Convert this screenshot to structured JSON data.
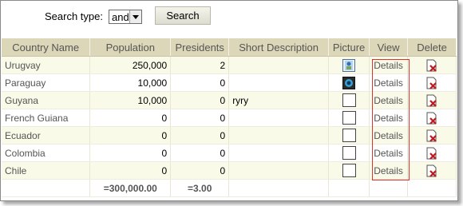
{
  "search": {
    "label": "Search type:",
    "type_value": "and",
    "button_label": "Search"
  },
  "columns": [
    "Country Name",
    "Population",
    "Presidents",
    "Short Description",
    "Picture",
    "View",
    "Delete"
  ],
  "rows": [
    {
      "country": "Urugvay",
      "population": "250,000",
      "presidents": "2",
      "description": "",
      "picture": "image-thumbnail",
      "view": "Details"
    },
    {
      "country": "Paraguay",
      "population": "10,000",
      "presidents": "0",
      "description": "",
      "picture": "camera-thumbnail",
      "view": "Details"
    },
    {
      "country": "Guyana",
      "population": "10,000",
      "presidents": "0",
      "description": "ryry",
      "picture": "empty",
      "view": "Details"
    },
    {
      "country": "French Guiana",
      "population": "0",
      "presidents": "0",
      "description": "",
      "picture": "empty",
      "view": "Details"
    },
    {
      "country": "Ecuador",
      "population": "0",
      "presidents": "0",
      "description": "",
      "picture": "empty",
      "view": "Details"
    },
    {
      "country": "Colombia",
      "population": "0",
      "presidents": "0",
      "description": "",
      "picture": "empty",
      "view": "Details"
    },
    {
      "country": "Chile",
      "population": "0",
      "presidents": "0",
      "description": "",
      "picture": "empty",
      "view": "Details"
    }
  ],
  "totals": {
    "population": "=300,000.00",
    "presidents": "=3.00"
  },
  "colors": {
    "header_bg": "#dcd7b8",
    "odd_row_bg": "#fafae8",
    "highlight_outline": "#e23030",
    "delete_icon": "#c0181e"
  }
}
